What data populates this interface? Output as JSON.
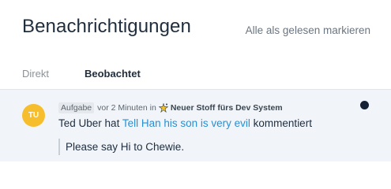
{
  "header": {
    "title": "Benachrichtigungen",
    "mark_all_read": "Alle als gelesen markieren"
  },
  "tabs": [
    {
      "label": "Direkt",
      "active": false
    },
    {
      "label": "Beobachtet",
      "active": true
    }
  ],
  "notification": {
    "avatar_initials": "TU",
    "avatar_color": "#f6bd2d",
    "type_badge": "Aufgabe",
    "time_prefix": "vor 2 Minuten in",
    "project_icon": "sparkle-star-icon",
    "project_name": "Neuer Stoff fürs Dev System",
    "actor": "Ted Uber",
    "verb": "hat",
    "task_title": "Tell Han his son is very evil",
    "action": "kommentiert",
    "comment": "Please say Hi to Chewie.",
    "unread": true
  },
  "colors": {
    "link": "#2a8fd0",
    "unread_dot": "#152135",
    "notification_bg": "#f1f5fa"
  }
}
